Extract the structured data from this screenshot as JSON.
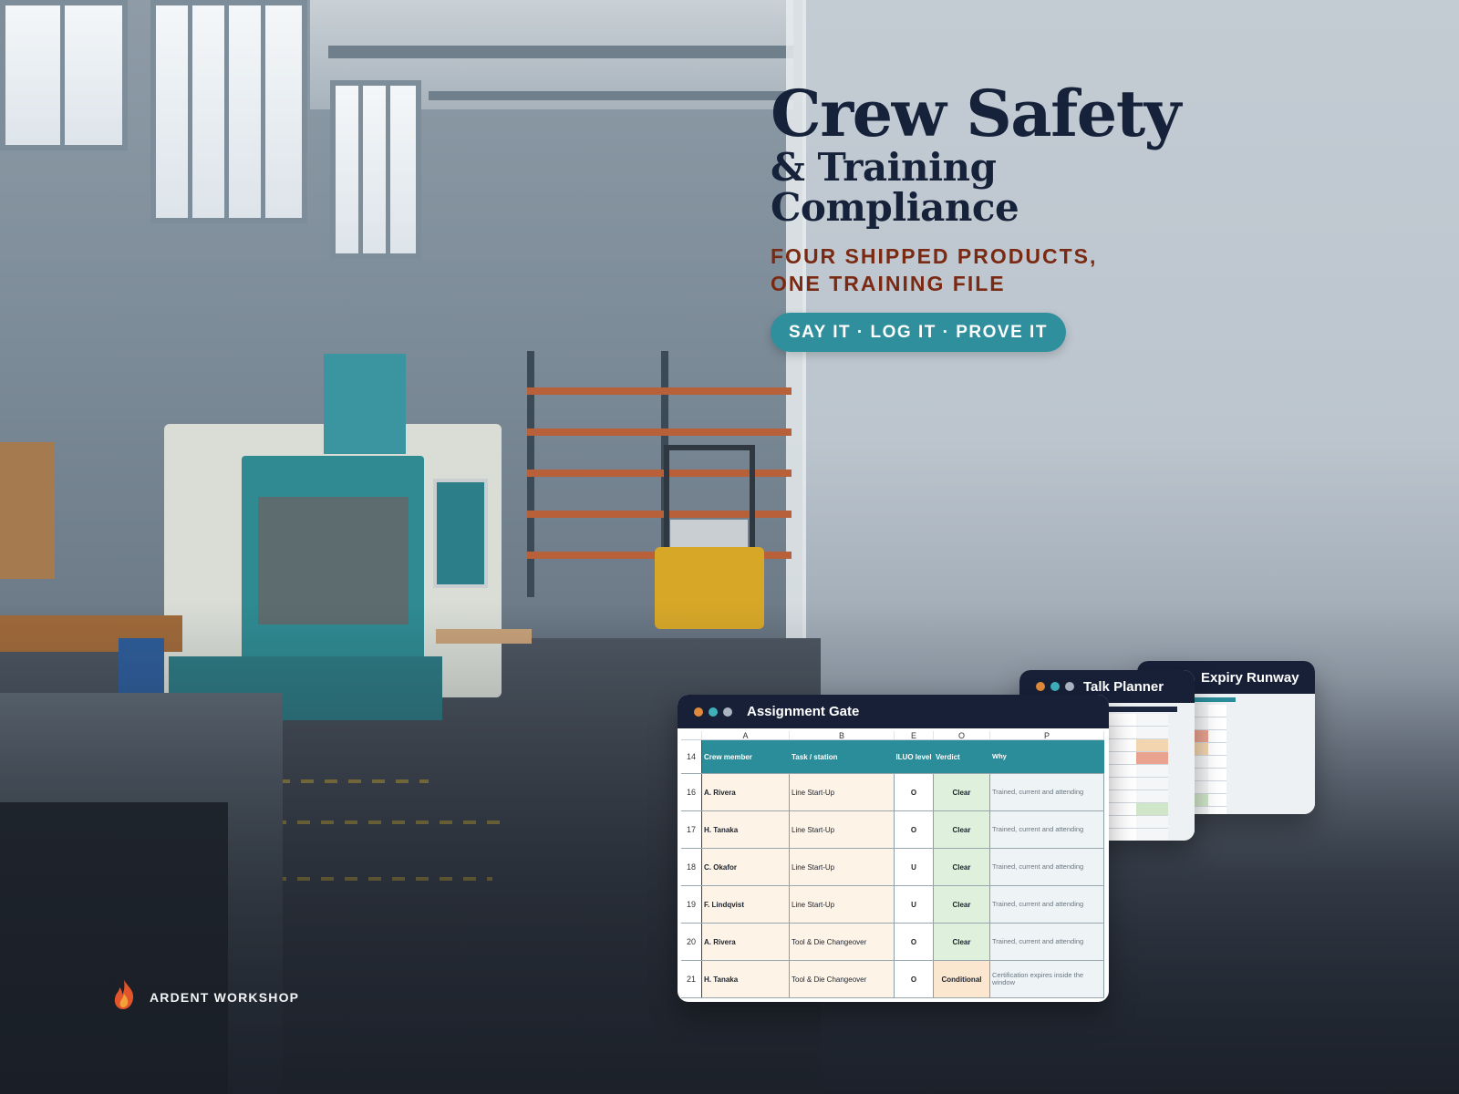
{
  "hero": {
    "title_line1": "Crew Safety",
    "title_line2": "& Training",
    "title_line3": "Compliance",
    "subtitle_line1": "FOUR SHIPPED PRODUCTS,",
    "subtitle_line2": "ONE TRAINING FILE",
    "tagline": "SAY IT · LOG IT · PROVE IT"
  },
  "brand": {
    "name": "ARDENT WORKSHOP",
    "icon": "flame-logo-icon"
  },
  "colors": {
    "navy": "#16213a",
    "rust": "#7a2a12",
    "teal": "#2f8f9c",
    "window_header": "#172037"
  },
  "windows": {
    "expiry": {
      "title": "Expiry Runway"
    },
    "talk": {
      "title": "Talk Planner"
    },
    "assignment": {
      "title": "Assignment Gate",
      "columns": [
        "A",
        "B",
        "E",
        "O",
        "P"
      ],
      "header_row": {
        "num": "14",
        "a": "Crew member",
        "b": "Task / station",
        "e": "ILUO level",
        "o": "Verdict",
        "p": "Why"
      },
      "rows": [
        {
          "num": "16",
          "a": "A. Rivera",
          "b": "Line Start-Up",
          "e": "O",
          "o": "Clear",
          "p": "Trained, current and attending"
        },
        {
          "num": "17",
          "a": "H. Tanaka",
          "b": "Line Start-Up",
          "e": "O",
          "o": "Clear",
          "p": "Trained, current and attending"
        },
        {
          "num": "18",
          "a": "C. Okafor",
          "b": "Line Start-Up",
          "e": "U",
          "o": "Clear",
          "p": "Trained, current and attending"
        },
        {
          "num": "19",
          "a": "F. Lindqvist",
          "b": "Line Start-Up",
          "e": "U",
          "o": "Clear",
          "p": "Trained, current and attending"
        },
        {
          "num": "20",
          "a": "A. Rivera",
          "b": "Tool & Die Changeover",
          "e": "O",
          "o": "Clear",
          "p": "Trained, current and attending"
        },
        {
          "num": "21",
          "a": "H. Tanaka",
          "b": "Tool & Die Changeover",
          "e": "O",
          "o": "Conditional",
          "p": "Certification expires inside the window"
        }
      ]
    }
  }
}
